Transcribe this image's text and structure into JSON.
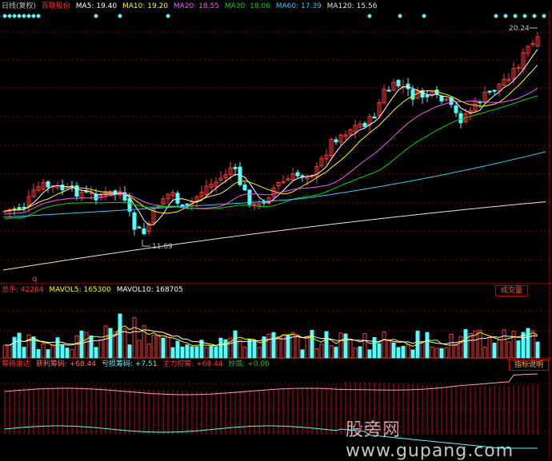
{
  "main": {
    "period": "日线(复权)",
    "stock": "百联股份",
    "ma": [
      {
        "label": "MA5: 19.40",
        "color": "#ffffff"
      },
      {
        "label": "MA10: 19.20",
        "color": "#ffff00"
      },
      {
        "label": "MA20: 18.55",
        "color": "#ff55ff"
      },
      {
        "label": "MA30: 18.06",
        "color": "#00dd00"
      },
      {
        "label": "MA60: 17.39",
        "color": "#33ccff"
      },
      {
        "label": "MA120: 15.56",
        "color": "#f0e6c8"
      }
    ],
    "high_label": "20.24",
    "low_label": "11.69"
  },
  "volume": {
    "title": "总手: 42264",
    "mavol5": "MAVOL5: 165300",
    "mavol10": "MAVOL10: 168705",
    "button": "成交量"
  },
  "chips": {
    "title": "筹码雷达",
    "profit": "获利筹码: +68.44",
    "loss": "亏损筹码: +7.51",
    "main_ctrl": "主力控筹: +68.44",
    "bottom": "抄底: +0.00",
    "button": "指标说明"
  },
  "marker": "q",
  "watermark": "股旁网 www.gupang.com",
  "colors": {
    "up": "#ff3a3a",
    "down": "#54ffff",
    "grid": "#8a0000",
    "bg": "#000000"
  }
}
